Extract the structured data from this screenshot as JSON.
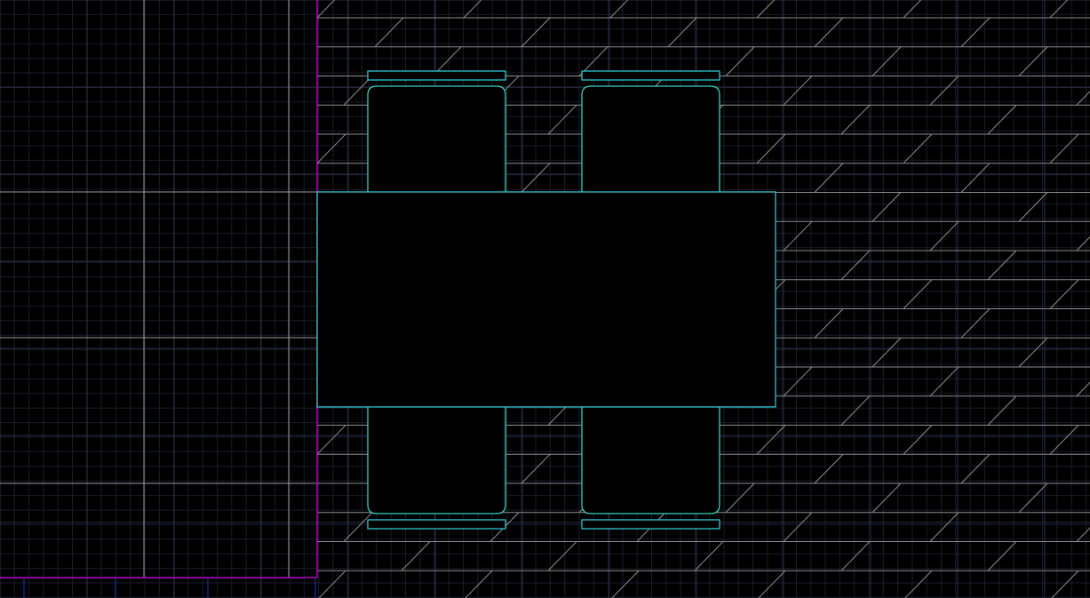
{
  "drawing": {
    "background": "#000000",
    "colors": {
      "grid_minor": "#171d2b",
      "grid_major": "#2d3148",
      "floor_line": "#9a9a9a",
      "wall_line": "#b000c8",
      "tile_line": "#8c8c8c",
      "furniture_line": "#2fc6d0",
      "chair_line": "#33d4c0",
      "blue_accent": "#1c33c8"
    },
    "objects": {
      "table": "dining-table-rectangle",
      "chairs": [
        "chair-top-left",
        "chair-top-right",
        "chair-bottom-left",
        "chair-bottom-right"
      ],
      "backrests": [
        "backrest-top-left",
        "backrest-top-right",
        "backrest-bottom-left",
        "backrest-bottom-right"
      ]
    }
  }
}
